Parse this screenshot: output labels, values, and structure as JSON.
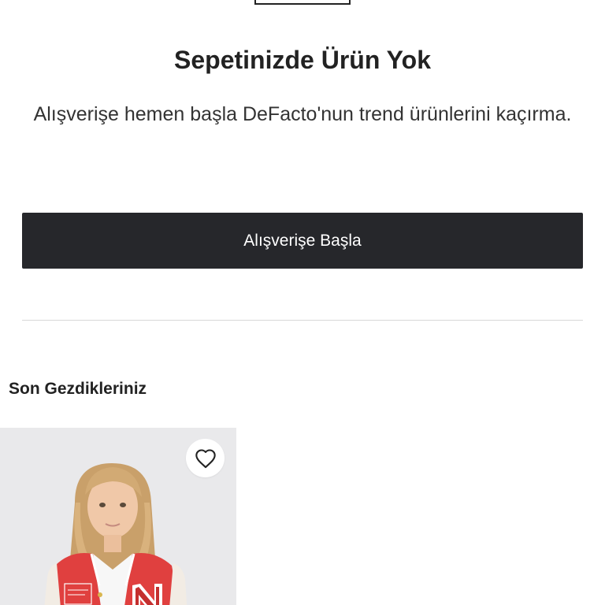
{
  "cart": {
    "empty_title": "Sepetinizde Ürün Yok",
    "empty_description": "Alışverişe hemen başla DeFacto'nun trend ürünlerini kaçırma.",
    "cta_label": "Alışverişe Başla"
  },
  "recently_viewed": {
    "title": "Son Gezdikleriniz"
  },
  "colors": {
    "button_bg": "#26272b",
    "jacket_red": "#e0403f"
  },
  "icons": {
    "favorite": "heart-outline-icon"
  }
}
